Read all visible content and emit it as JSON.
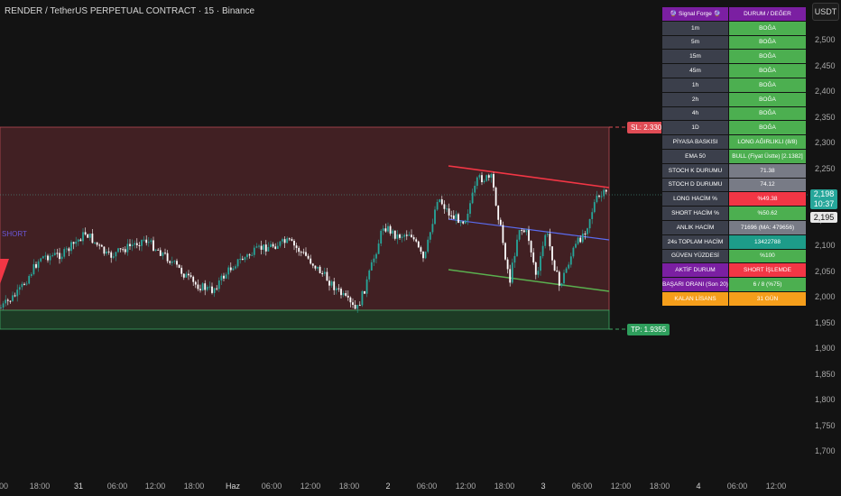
{
  "header": {
    "title": "RENDER / TetherUS PERPETUAL CONTRACT · 15 · Binance",
    "currency_button": "USDT"
  },
  "colors": {
    "background": "#131313",
    "up_candle": "#26a69a",
    "down_candle": "#ffffff",
    "sl_zone": "#5a2a2e",
    "tp_zone": "#1f4a2c",
    "bull": "#4caf50",
    "bear": "#f23645",
    "gray": "#787b86",
    "teal": "#1d9c89",
    "purple": "#7b1fa2",
    "orange": "#f59e1b"
  },
  "y_axis": {
    "ticks": [
      "2,500",
      "2,450",
      "2,400",
      "2,350",
      "2,300",
      "2,250",
      "2,200",
      "2,150",
      "2,100",
      "2,050",
      "2,000",
      "1,950",
      "1,900",
      "1,850",
      "1,800",
      "1,750",
      "1,700"
    ]
  },
  "x_axis": {
    "ticks": [
      "00",
      "18:00",
      "31",
      "06:00",
      "12:00",
      "18:00",
      "Haz",
      "06:00",
      "12:00",
      "18:00",
      "2",
      "06:00",
      "12:00",
      "18:00",
      "3",
      "06:00",
      "12:00",
      "18:00",
      "4",
      "06:00",
      "12:00"
    ]
  },
  "levels": {
    "sl_label": "SL: 2.3305",
    "tp_label": "TP: 1.9355",
    "short_label": "SHORT"
  },
  "price": {
    "current": "2,198",
    "countdown": "10:37",
    "secondary": "2,195"
  },
  "signal_table": {
    "header_left": "🔮 Signal Forge 🔮",
    "header_right": "DURUM / DEĞER",
    "rows": [
      {
        "label": "1m",
        "value": "BOĞA",
        "color": "bull"
      },
      {
        "label": "5m",
        "value": "BOĞA",
        "color": "bull"
      },
      {
        "label": "15m",
        "value": "BOĞA",
        "color": "bull"
      },
      {
        "label": "45m",
        "value": "BOĞA",
        "color": "bull"
      },
      {
        "label": "1h",
        "value": "BOĞA",
        "color": "bull"
      },
      {
        "label": "2h",
        "value": "BOĞA",
        "color": "bull"
      },
      {
        "label": "4h",
        "value": "BOĞA",
        "color": "bull"
      },
      {
        "label": "1D",
        "value": "BOĞA",
        "color": "bull"
      },
      {
        "label": "PİYASA BASKISI",
        "value": "LONG AĞIRLIKLI (8/8)",
        "color": "bull"
      },
      {
        "label": "EMA 50",
        "value": "BULL (Fiyat Üstte) [2.1382]",
        "color": "bull"
      },
      {
        "label": "STOCH K DURUMU",
        "value": "71.38",
        "color": "gray"
      },
      {
        "label": "STOCH D DURUMU",
        "value": "74.12",
        "color": "gray"
      },
      {
        "label": "LONG HACİM %",
        "value": "%49.38",
        "color": "bear"
      },
      {
        "label": "SHORT HACİM %",
        "value": "%50.62",
        "color": "bull"
      },
      {
        "label": "ANLIK HACİM",
        "value": "71696 (MA: 479656)",
        "color": "gray"
      },
      {
        "label": "24s TOPLAM HACİM",
        "value": "13422788",
        "color": "teal"
      },
      {
        "label": "GÜVEN YÜZDESİ",
        "value": "%100",
        "color": "bull"
      },
      {
        "label": "AKTİF DURUM",
        "value": "SHORT İŞLEMDE",
        "color": "bear"
      },
      {
        "label": "BAŞARI ORANI (Son 20)",
        "value": "6 / 8 (%75)",
        "color": "bull"
      },
      {
        "label": "KALAN LİSANS",
        "value": "31 GÜN",
        "color": "orange"
      }
    ]
  }
}
